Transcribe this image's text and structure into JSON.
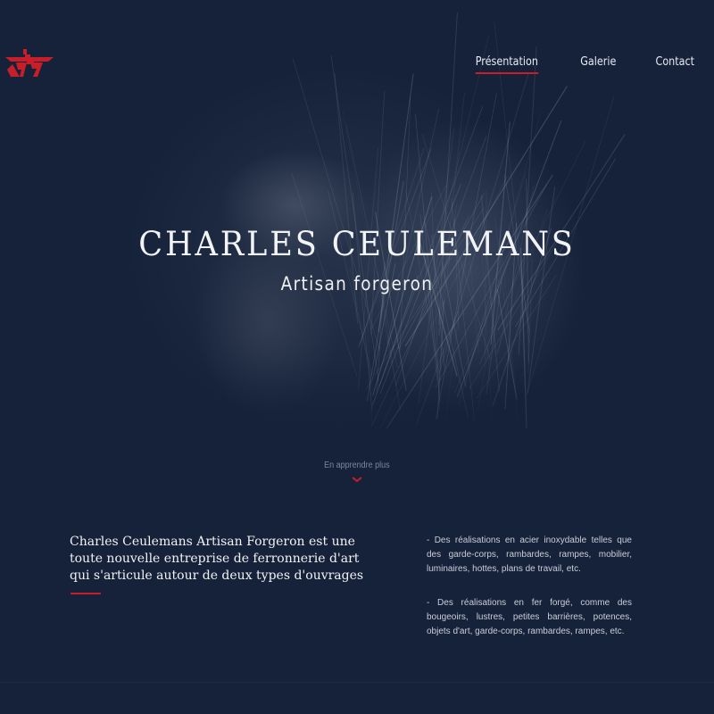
{
  "header": {
    "logo_icon": "anvil-cf-logo-icon",
    "brand_color": "#c81e2a",
    "nav": [
      {
        "label": "Présentation",
        "active": true
      },
      {
        "label": "Galerie",
        "active": false
      },
      {
        "label": "Contact",
        "active": false
      }
    ]
  },
  "hero": {
    "title": "CHARLES CEULEMANS",
    "subtitle": "Artisan forgeron",
    "learn_more": "En apprendre plus",
    "chevron_icon": "chevron-down-icon"
  },
  "content": {
    "intro": "Charles Ceulemans Artisan Forgeron est une toute nouvelle entreprise de ferronnerie d'art qui s'articule autour de deux types d'ouvrages",
    "items": [
      "- Des réalisations en acier inoxydable telles que des garde-corps, rambardes, rampes, mobilier, luminaires, hottes, plans de travail, etc.",
      "- Des réalisations en fer forgé, comme des bougeoirs, lustres, petites barrières, potences, objets d'art, garde-corps, rambardes, rampes, etc."
    ]
  },
  "colors": {
    "background": "#16223a",
    "accent": "#c81e2a",
    "text": "#f1f2f5"
  }
}
